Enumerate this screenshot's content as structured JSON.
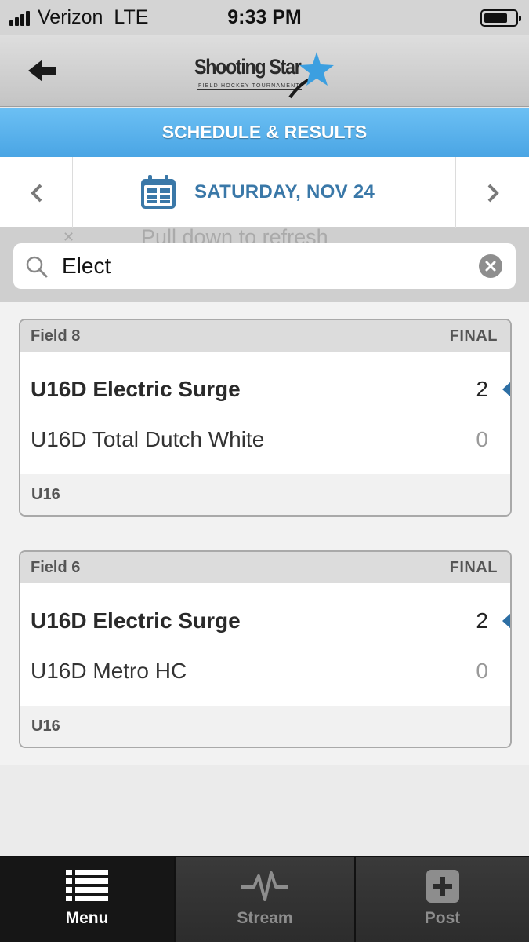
{
  "status_bar": {
    "carrier": "Verizon",
    "network": "LTE",
    "time": "9:33 PM",
    "battery_level": 0.75
  },
  "header": {
    "logo_title": "Shooting Star",
    "logo_subtitle": "FIELD HOCKEY TOURNAMENT",
    "back_icon": "arrow-left-icon"
  },
  "section": {
    "title": "SCHEDULE & RESULTS"
  },
  "date_nav": {
    "date": "SATURDAY, NOV 24",
    "prev_icon": "chevron-left-icon",
    "next_icon": "chevron-right-icon",
    "calendar_icon": "calendar-icon"
  },
  "refresh": {
    "hint": "Pull down to refresh"
  },
  "search": {
    "value": "Elect"
  },
  "games": [
    {
      "field": "Field 8",
      "status": "FINAL",
      "team1": "U16D Electric Surge",
      "score1": "2",
      "team2": "U16D Total Dutch White",
      "score2": "0",
      "division": "U16"
    },
    {
      "field": "Field 6",
      "status": "FINAL",
      "team1": "U16D Electric Surge",
      "score1": "2",
      "team2": "U16D Metro HC",
      "score2": "0",
      "division": "U16"
    }
  ],
  "tabs": [
    {
      "label": "Menu",
      "icon": "list-icon",
      "active": true
    },
    {
      "label": "Stream",
      "icon": "pulse-icon",
      "active": false
    },
    {
      "label": "Post",
      "icon": "plus-icon",
      "active": false
    }
  ],
  "colors": {
    "accent_blue": "#4aa5e4",
    "date_text": "#3a78a8",
    "win_marker": "#2d6fa4",
    "tab_bar": "#2a2a2a"
  }
}
